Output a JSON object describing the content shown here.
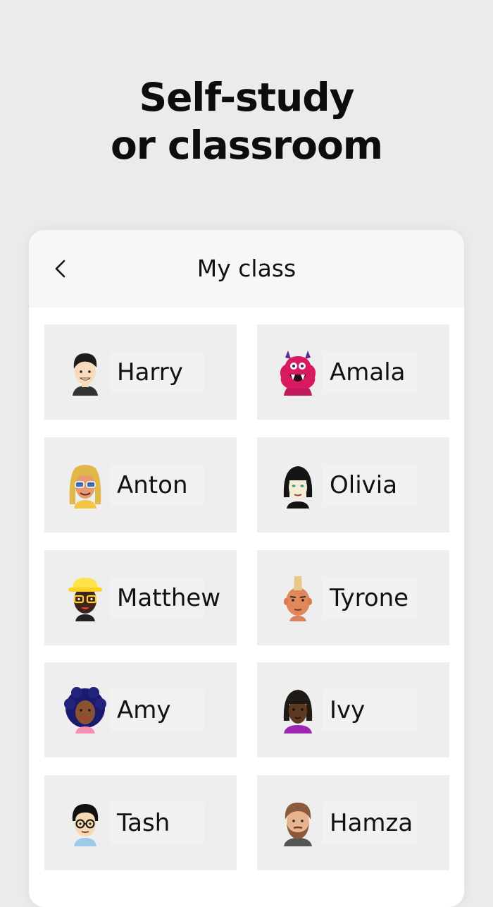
{
  "headline": {
    "line1": "Self-study",
    "line2": "or classroom"
  },
  "class_screen": {
    "title": "My class",
    "back_icon": "chevron-left-icon",
    "students": [
      {
        "name": "Harry",
        "avatar": "boy-dark-hair-avatar"
      },
      {
        "name": "Amala",
        "avatar": "pink-monster-avatar"
      },
      {
        "name": "Anton",
        "avatar": "blond-sunglasses-avatar"
      },
      {
        "name": "Olivia",
        "avatar": "girl-black-bob-avatar"
      },
      {
        "name": "Matthew",
        "avatar": "yellow-hat-glasses-avatar"
      },
      {
        "name": "Tyrone",
        "avatar": "mohawk-avatar"
      },
      {
        "name": "Amy",
        "avatar": "curly-hair-avatar"
      },
      {
        "name": "Ivy",
        "avatar": "girl-bangs-avatar"
      },
      {
        "name": "Tash",
        "avatar": "glasses-bowl-cut-avatar"
      },
      {
        "name": "Hamza",
        "avatar": "bearded-avatar"
      }
    ]
  },
  "colors": {
    "background": "#ebebeb",
    "card": "#ffffff",
    "card_header": "#f7f7f7",
    "tile": "#eeeeee",
    "text": "#111111"
  }
}
